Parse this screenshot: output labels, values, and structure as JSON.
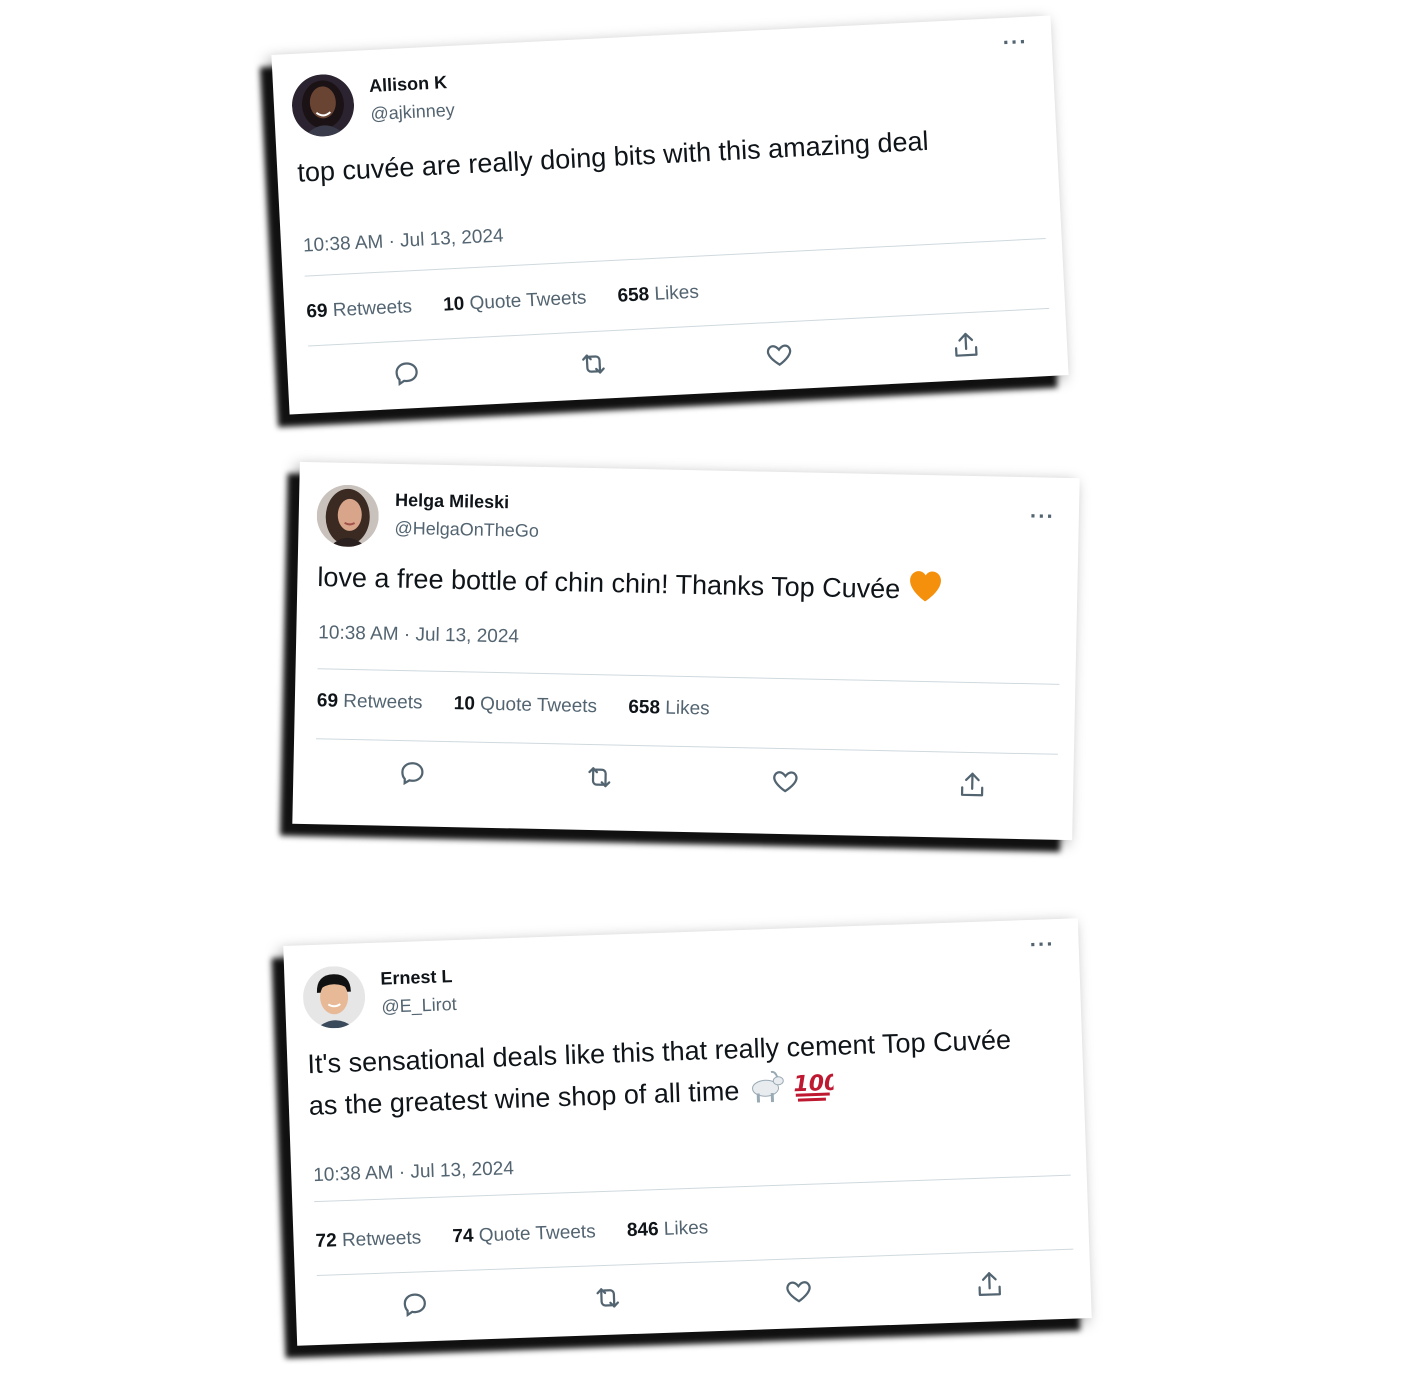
{
  "tweets": [
    {
      "name": "Allison K",
      "handle": "@ajkinney",
      "text": "top cuvée are really doing bits with this amazing deal",
      "timestamp": "10:38 AM · Jul 13, 2024",
      "retweets": "69",
      "retweets_label": "Retweets",
      "quotes": "10",
      "quotes_label": "Quote Tweets",
      "likes": "658",
      "likes_label": "Likes",
      "more": "···",
      "avatar_colors": {
        "bg": "#2b2430",
        "skin": "#6a4433",
        "hair": "#1a1214"
      }
    },
    {
      "name": "Helga Mileski",
      "handle": "@HelgaOnTheGo",
      "text": "love a free bottle of chin chin! Thanks Top Cuvée",
      "emoji": "orange-heart",
      "timestamp": "10:38 AM · Jul 13, 2024",
      "retweets": "69",
      "retweets_label": "Retweets",
      "quotes": "10",
      "quotes_label": "Quote Tweets",
      "likes": "658",
      "likes_label": "Likes",
      "more": "···",
      "avatar_colors": {
        "bg": "#c9c2bc",
        "skin": "#d8a48a",
        "hair": "#3a2a22"
      }
    },
    {
      "name": "Ernest L",
      "handle": "@E_Lirot",
      "text": "It's sensational deals like this that really cement Top Cuvée as the greatest wine shop of all time",
      "emoji": "goat, hundred-points",
      "timestamp": "10:38 AM · Jul 13, 2024",
      "retweets": "72",
      "retweets_label": "Retweets",
      "quotes": "74",
      "quotes_label": "Quote Tweets",
      "likes": "846",
      "likes_label": "Likes",
      "more": "···",
      "avatar_colors": {
        "bg": "#e6e6e6",
        "skin": "#e7b996",
        "hair": "#111111"
      }
    }
  ],
  "colors": {
    "text_primary": "#0f1419",
    "text_secondary": "#536471",
    "divider": "#cfd9de",
    "orange_heart": "#f4900c",
    "hundred_red": "#be1931"
  },
  "icons": [
    "reply-icon",
    "retweet-icon",
    "like-icon",
    "share-icon",
    "more-icon"
  ]
}
